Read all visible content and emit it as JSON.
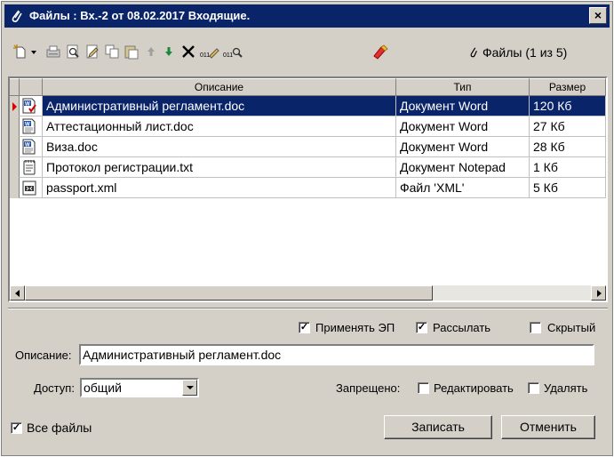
{
  "window": {
    "title": "Файлы : Вх.-2 от 08.02.2017 Входящие.",
    "close_label": "×"
  },
  "toolbar": {
    "files_counter": "Файлы (1 из 5)",
    "icons": [
      "new-file-icon",
      "dropdown-arrow-icon",
      "scan-icon",
      "preview-icon",
      "edit-icon",
      "copy-icon",
      "paste-icon",
      "move-up-icon",
      "move-down-icon",
      "delete-icon",
      "sign-icon",
      "verify-signature-icon",
      "stamp-icon"
    ]
  },
  "grid": {
    "columns": [
      "Описание",
      "Тип",
      "Размер"
    ],
    "rows": [
      {
        "description": "Административный регламент.doc",
        "type": "Документ Word",
        "size": "120 Кб",
        "icon": "word-signed-icon",
        "selected": true
      },
      {
        "description": "Аттестационный лист.doc",
        "type": "Документ Word",
        "size": "27 Кб",
        "icon": "word-icon",
        "selected": false
      },
      {
        "description": "Виза.doc",
        "type": "Документ Word",
        "size": "28 Кб",
        "icon": "word-icon",
        "selected": false
      },
      {
        "description": "Протокол регистрации.txt",
        "type": "Документ Notepad",
        "size": "1 Кб",
        "icon": "notepad-icon",
        "selected": false
      },
      {
        "description": "passport.xml",
        "type": "Файл 'XML'",
        "size": "5 Кб",
        "icon": "xml-icon",
        "selected": false
      }
    ]
  },
  "options": {
    "apply_ep": {
      "label": "Применять ЭП",
      "checked": true
    },
    "send": {
      "label": "Рассылать",
      "checked": true
    },
    "hidden": {
      "label": "Скрытый",
      "checked": false
    }
  },
  "form": {
    "description_label": "Описание:",
    "description_value": "Административный регламент.doc",
    "access_label": "Доступ:",
    "access_value": "общий",
    "forbidden_label": "Запрещено:",
    "edit": {
      "label": "Редактировать",
      "checked": false
    },
    "delete": {
      "label": "Удалять",
      "checked": false
    }
  },
  "footer": {
    "all_files": {
      "label": "Все файлы",
      "checked": true
    },
    "save_label": "Записать",
    "cancel_label": "Отменить"
  },
  "colors": {
    "titlebar": "#0a246a",
    "selection": "#0a246a",
    "window_bg": "#d4d0c8"
  }
}
